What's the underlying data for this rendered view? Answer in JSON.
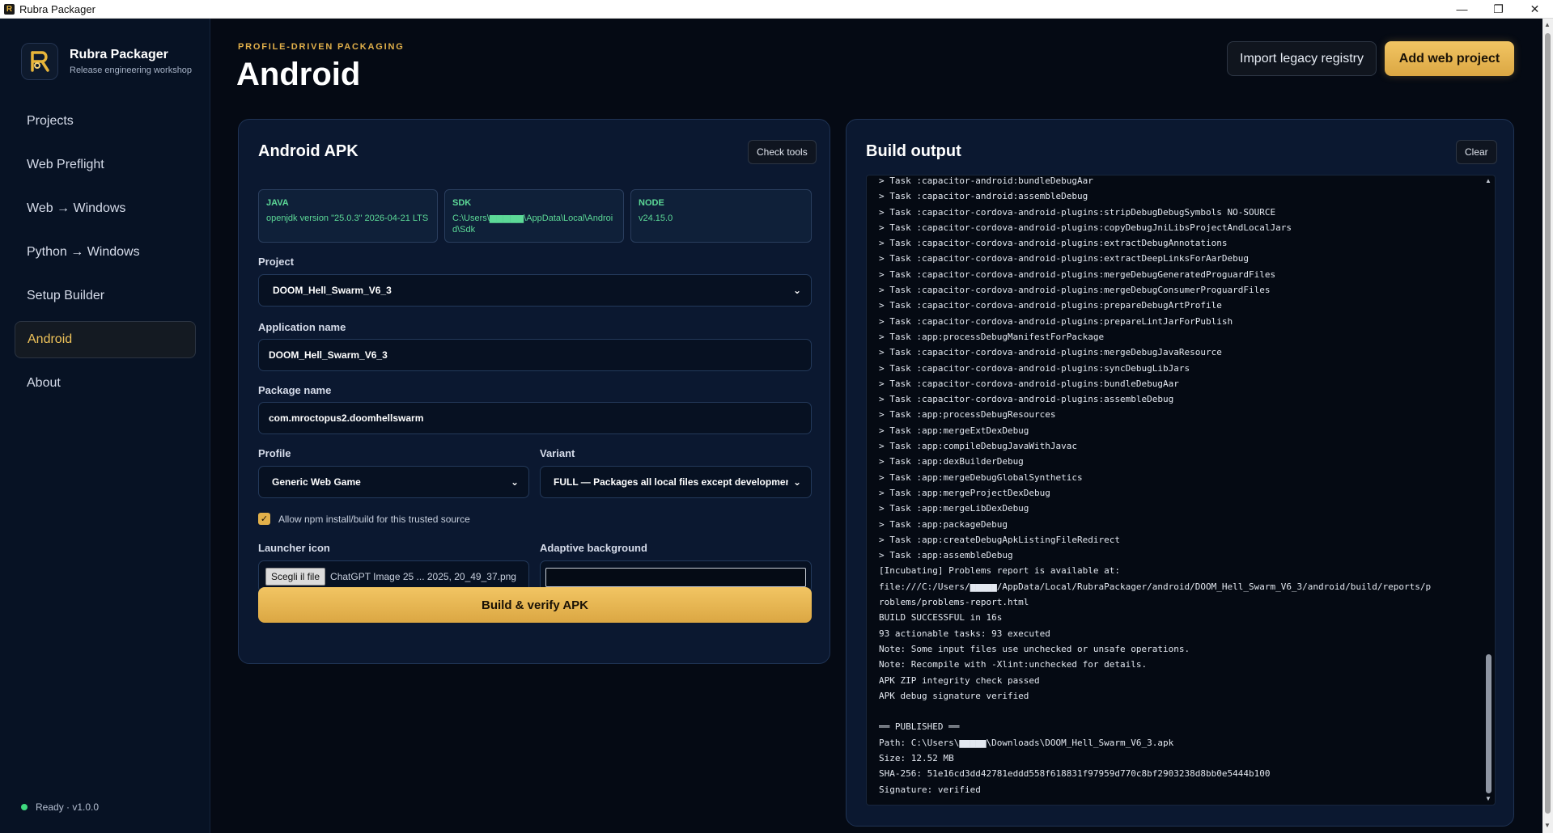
{
  "window": {
    "title": "Rubra Packager",
    "minimize": "—",
    "restore": "❐",
    "close": "✕"
  },
  "brand": {
    "name": "Rubra Packager",
    "subtitle": "Release engineering workshop"
  },
  "nav": {
    "items": [
      {
        "label": "Projects"
      },
      {
        "label": "Web Preflight"
      },
      {
        "label": "Web → Windows"
      },
      {
        "label": "Python → Windows"
      },
      {
        "label": "Setup Builder"
      },
      {
        "label": "Android",
        "active": true
      },
      {
        "label": "About"
      }
    ]
  },
  "status": {
    "text": "Ready · v1.0.0",
    "color": "#3fd97f"
  },
  "header": {
    "kicker": "PROFILE-DRIVEN PACKAGING",
    "title": "Android",
    "import_label": "Import legacy registry",
    "add_label": "Add web project"
  },
  "apk_panel": {
    "title": "Android APK",
    "check_tools_label": "Check tools",
    "tools": {
      "java": {
        "label": "JAVA",
        "value": "openjdk version \"25.0.3\" 2026-04-21 LTS"
      },
      "sdk": {
        "label": "SDK",
        "value": "C:\\Users\\▆▆▆▆▆\\AppData\\Local\\Android\\Sdk"
      },
      "node": {
        "label": "NODE",
        "value": "v24.15.0"
      }
    },
    "project": {
      "label": "Project",
      "value": "DOOM_Hell_Swarm_V6_3"
    },
    "app_name": {
      "label": "Application name",
      "value": "DOOM_Hell_Swarm_V6_3"
    },
    "package_name": {
      "label": "Package name",
      "value": "com.mroctopus2.doomhellswarm"
    },
    "profile": {
      "label": "Profile",
      "value": "Generic Web Game"
    },
    "variant": {
      "label": "Variant",
      "value": "FULL — Packages all local files except development"
    },
    "npm_checkbox": {
      "label": "Allow npm install/build for this trusted source",
      "checked": true
    },
    "launcher_icon": {
      "label": "Launcher icon",
      "button": "Scegli il file",
      "file": "ChatGPT Image 25 ... 2025, 20_49_37.png"
    },
    "adaptive_bg": {
      "label": "Adaptive background"
    },
    "build_label": "Build & verify APK"
  },
  "output_panel": {
    "title": "Build output",
    "clear_label": "Clear",
    "lines": [
      "> Task :capacitor-android:bundleDebugAar",
      "> Task :capacitor-android:assembleDebug",
      "> Task :capacitor-cordova-android-plugins:stripDebugDebugSymbols NO-SOURCE",
      "> Task :capacitor-cordova-android-plugins:copyDebugJniLibsProjectAndLocalJars",
      "> Task :capacitor-cordova-android-plugins:extractDebugAnnotations",
      "> Task :capacitor-cordova-android-plugins:extractDeepLinksForAarDebug",
      "> Task :capacitor-cordova-android-plugins:mergeDebugGeneratedProguardFiles",
      "> Task :capacitor-cordova-android-plugins:mergeDebugConsumerProguardFiles",
      "> Task :capacitor-cordova-android-plugins:prepareDebugArtProfile",
      "> Task :capacitor-cordova-android-plugins:prepareLintJarForPublish",
      "> Task :app:processDebugManifestForPackage",
      "> Task :capacitor-cordova-android-plugins:mergeDebugJavaResource",
      "> Task :capacitor-cordova-android-plugins:syncDebugLibJars",
      "> Task :capacitor-cordova-android-plugins:bundleDebugAar",
      "> Task :capacitor-cordova-android-plugins:assembleDebug",
      "> Task :app:processDebugResources",
      "> Task :app:mergeExtDexDebug",
      "> Task :app:compileDebugJavaWithJavac",
      "> Task :app:dexBuilderDebug",
      "> Task :app:mergeDebugGlobalSynthetics",
      "> Task :app:mergeProjectDexDebug",
      "> Task :app:mergeLibDexDebug",
      "> Task :app:packageDebug",
      "> Task :app:createDebugApkListingFileRedirect",
      "> Task :app:assembleDebug",
      "[Incubating] Problems report is available at:",
      "file:///C:/Users/▆▆▆▆▆/AppData/Local/RubraPackager/android/DOOM_Hell_Swarm_V6_3/android/build/reports/p",
      "roblems/problems-report.html",
      "BUILD SUCCESSFUL in 16s",
      "93 actionable tasks: 93 executed",
      "Note: Some input files use unchecked or unsafe operations.",
      "Note: Recompile with -Xlint:unchecked for details.",
      "APK ZIP integrity check passed",
      "APK debug signature verified",
      "",
      "══ PUBLISHED ══",
      "Path: C:\\Users\\▆▆▆▆▆\\Downloads\\DOOM_Hell_Swarm_V6_3.apk",
      "Size: 12.52 MB",
      "SHA-256: 51e16cd3dd42781eddd558f618831f97959d770c8bf2903238d8bb0e5444b100",
      "Signature: verified"
    ]
  },
  "colors": {
    "accent": "#e2b04a",
    "tool_ok": "#5cd997",
    "panel_bg": "#0b1830"
  }
}
